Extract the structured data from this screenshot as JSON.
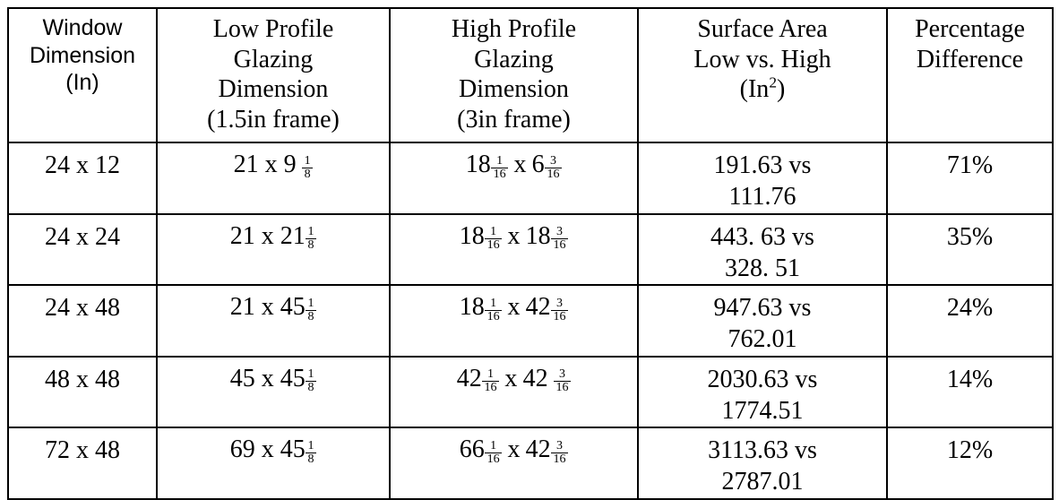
{
  "table": {
    "headers": [
      {
        "id": "window-dimension",
        "lines": [
          "Window",
          "Dimension",
          "(In)"
        ],
        "style": "sans"
      },
      {
        "id": "low-profile-glazing-dimension",
        "lines": [
          "Low Profile",
          "Glazing",
          "Dimension",
          "(1.5in frame)"
        ],
        "style": "serif"
      },
      {
        "id": "high-profile-glazing-dimension",
        "lines": [
          "High Profile",
          "Glazing",
          "Dimension",
          "(3in frame)"
        ],
        "style": "serif"
      },
      {
        "id": "surface-area-low-vs-high",
        "lines": [
          "Surface Area",
          "Low vs. High",
          "(In²)"
        ],
        "style": "serif"
      },
      {
        "id": "percentage-difference",
        "lines": [
          "Percentage",
          "Difference"
        ],
        "style": "serif"
      }
    ],
    "rows": [
      {
        "window_dimension": "24 x 12",
        "low_profile": {
          "text": "21 x 9",
          "fraction": {
            "num": "1",
            "den": "8"
          },
          "space_before_fraction": true
        },
        "high_profile": {
          "a_whole": "18",
          "a_num": "1",
          "a_den": "16",
          "sep": "x",
          "b_whole": "6",
          "b_num": "3",
          "b_den": "16",
          "space_before_b_fraction": false
        },
        "surface_area": [
          "191.63 vs",
          "111.76"
        ],
        "percentage": "71%"
      },
      {
        "window_dimension": "24 x 24",
        "low_profile": {
          "text": "21 x 21",
          "fraction": {
            "num": "1",
            "den": "8"
          },
          "space_before_fraction": false
        },
        "high_profile": {
          "a_whole": "18",
          "a_num": "1",
          "a_den": "16",
          "sep": "x",
          "b_whole": "18",
          "b_num": "3",
          "b_den": "16",
          "space_before_b_fraction": false
        },
        "surface_area": [
          "443. 63 vs",
          "328. 51"
        ],
        "percentage": "35%"
      },
      {
        "window_dimension": "24 x 48",
        "low_profile": {
          "text": "21 x 45",
          "fraction": {
            "num": "1",
            "den": "8"
          },
          "space_before_fraction": false
        },
        "high_profile": {
          "a_whole": "18",
          "a_num": "1",
          "a_den": "16",
          "sep": "x",
          "b_whole": "42",
          "b_num": "3",
          "b_den": "16",
          "space_before_b_fraction": false
        },
        "surface_area": [
          "947.63 vs",
          "762.01"
        ],
        "percentage": "24%"
      },
      {
        "window_dimension": "48 x 48",
        "low_profile": {
          "text": "45 x 45",
          "fraction": {
            "num": "1",
            "den": "8"
          },
          "space_before_fraction": false
        },
        "high_profile": {
          "a_whole": "42",
          "a_num": "1",
          "a_den": "16",
          "sep": "x",
          "b_whole": "42",
          "b_num": "3",
          "b_den": "16",
          "space_before_b_fraction": true
        },
        "surface_area": [
          "2030.63 vs",
          "1774.51"
        ],
        "percentage": "14%"
      },
      {
        "window_dimension": "72 x 48",
        "low_profile": {
          "text": "69 x 45",
          "fraction": {
            "num": "1",
            "den": "8"
          },
          "space_before_fraction": false
        },
        "high_profile": {
          "a_whole": "66",
          "a_num": "1",
          "a_den": "16",
          "sep": "x",
          "b_whole": "42",
          "b_num": "3",
          "b_den": "16",
          "space_before_b_fraction": false
        },
        "surface_area": [
          "3113.63 vs",
          "2787.01"
        ],
        "percentage": "12%"
      }
    ]
  },
  "colors": {
    "border": "#000000",
    "text": "#000000",
    "background": "#ffffff"
  }
}
